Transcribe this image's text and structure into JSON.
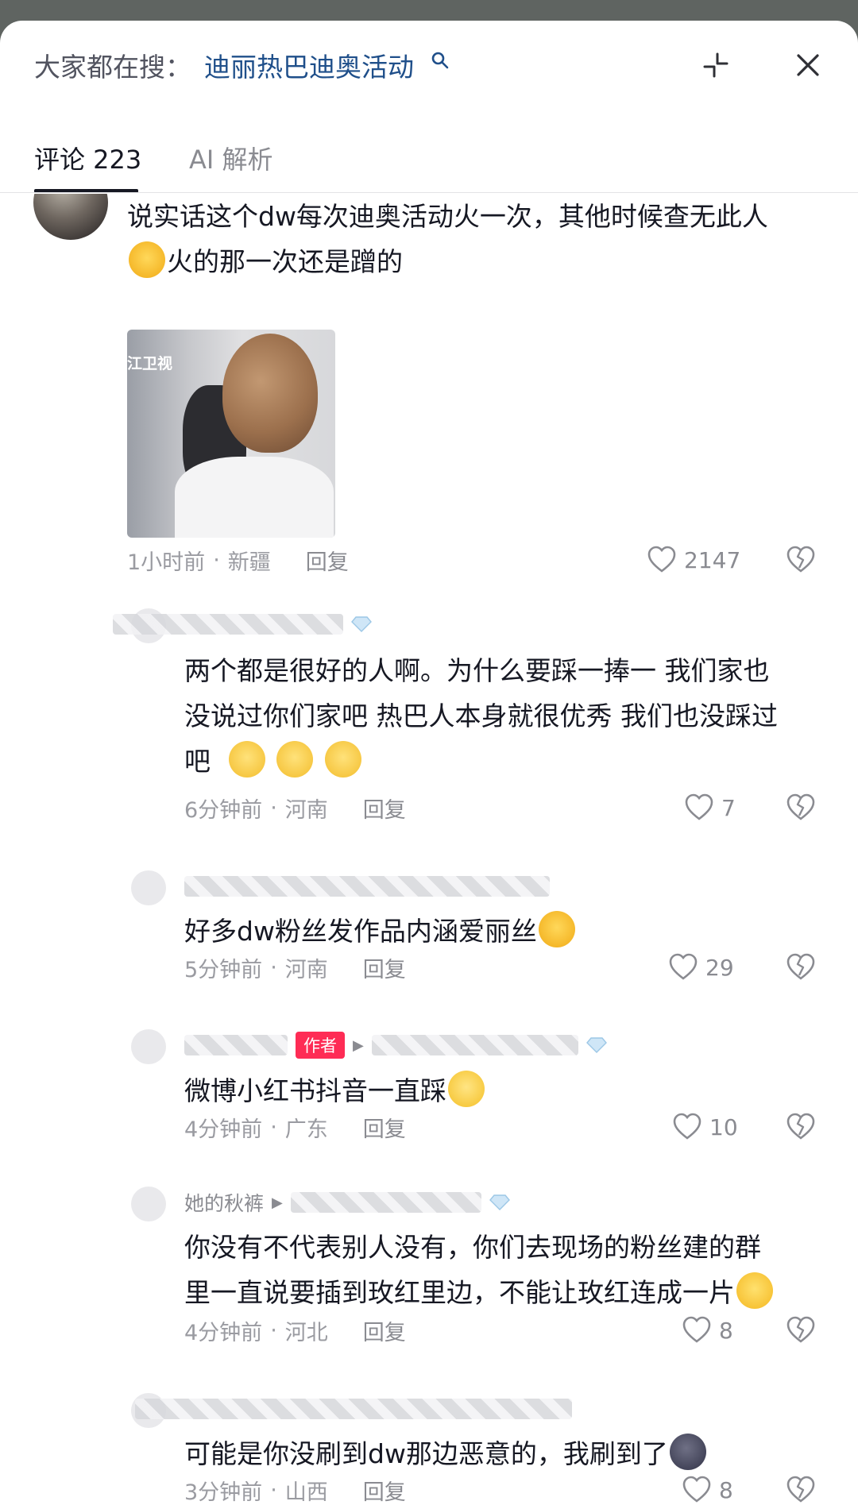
{
  "header": {
    "search_prefix": "大家都在搜：",
    "search_term": "迪丽热巴迪奥活动"
  },
  "tabs": {
    "comments_label": "评论 223",
    "ai_label": "AI 解析"
  },
  "comments": [
    {
      "text_line1": "说实话这个dw每次迪奥活动火一次，其他时候查无此人",
      "text_line2": "火的那一次还是蹭的",
      "photo_watermark": "江卫视",
      "time": "1小时前",
      "location": "新疆",
      "reply_label": "回复",
      "likes": "2147"
    }
  ],
  "replies": [
    {
      "text_line1": "两个都是很好的人啊。为什么要踩一捧一 我们家也",
      "text_line2": "没说过你们家吧 热巴人本身就很优秀 我们也没踩过",
      "text_line3": "吧",
      "time": "6分钟前",
      "location": "河南",
      "reply_label": "回复",
      "likes": "7"
    },
    {
      "text": "好多dw粉丝发作品内涵爱丽丝",
      "time": "5分钟前",
      "location": "河南",
      "reply_label": "回复",
      "likes": "29"
    },
    {
      "badge": "作者",
      "text": "微博小红书抖音一直踩",
      "time": "4分钟前",
      "location": "广东",
      "reply_label": "回复",
      "likes": "10"
    },
    {
      "name": "她的秋裤",
      "text_line1": "你没有不代表别人没有，你们去现场的粉丝建的群",
      "text_line2": "里一直说要插到玫红里边，不能让玫红连成一片",
      "time": "4分钟前",
      "location": "河北",
      "reply_label": "回复",
      "likes": "8"
    },
    {
      "text": "可能是你没刷到dw那边恶意的，我刷到了",
      "time": "3分钟前",
      "location": "山西",
      "reply_label": "回复",
      "likes": "8"
    }
  ],
  "meta_separator": "·",
  "icons": {
    "search": "search-icon",
    "collapse": "collapse-icon",
    "close": "close-icon",
    "like": "heart-icon",
    "dislike": "broken-heart-icon",
    "level": "diamond-icon"
  },
  "colors": {
    "link": "#1f4f8a",
    "author_badge": "#fe2c55",
    "secondary_text": "#8a8b91"
  }
}
